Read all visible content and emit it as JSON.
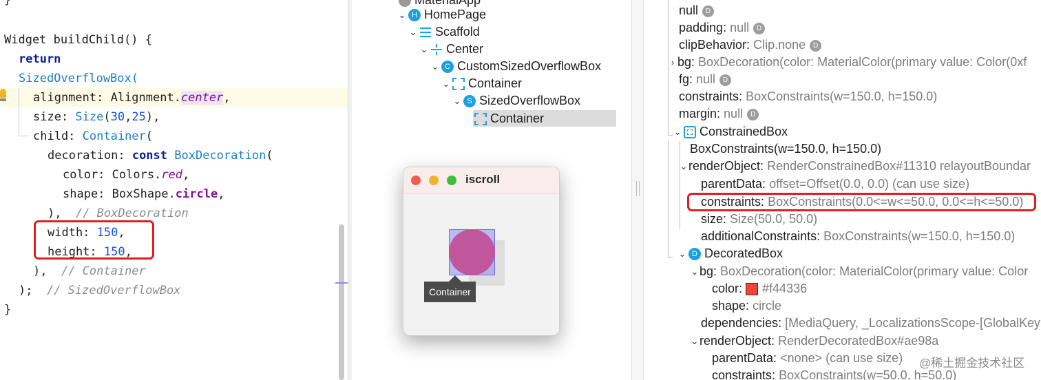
{
  "editor": {
    "top_fragment": "}",
    "lines": [
      {
        "t": "Widget buildChild() {"
      },
      {
        "t": "return"
      },
      {
        "t": "SizedOverflowBox("
      },
      {
        "a": "alignment: Alignment.",
        "b": "center",
        "c": ","
      },
      {
        "a": "size: ",
        "b": "Size",
        "c": "(",
        "d": "30",
        "e": ",",
        "f": "25",
        "g": "),"
      },
      {
        "a": "child: ",
        "b": "Container",
        "c": "("
      },
      {
        "a": "decoration: ",
        "b": "const",
        "c": " ",
        "d": "BoxDecoration",
        "e": "("
      },
      {
        "a": "color: Colors.",
        "b": "red",
        "c": ","
      },
      {
        "a": "shape: BoxShape.",
        "b": "circle",
        "c": ","
      },
      {
        "a": "),  ",
        "b": "// BoxDecoration"
      },
      {
        "a": "width: ",
        "b": "150",
        "c": ","
      },
      {
        "a": "height: ",
        "b": "150",
        "c": ","
      },
      {
        "a": "),  ",
        "b": "// Container"
      },
      {
        "a": ");  ",
        "b": "// SizedOverflowBox"
      },
      {
        "t": "}"
      }
    ]
  },
  "tree": {
    "items": [
      {
        "label": "MaterialApp",
        "badge": ""
      },
      {
        "label": "HomePage",
        "badge": "H"
      },
      {
        "label": "Scaffold"
      },
      {
        "label": "Center"
      },
      {
        "label": "CustomSizedOverflowBox",
        "badge": "C"
      },
      {
        "label": "Container"
      },
      {
        "label": "SizedOverflowBox",
        "badge": "S"
      },
      {
        "label": "Container"
      }
    ],
    "selected_index": 7
  },
  "app_window": {
    "title": "iscroll",
    "tooltip": "Container",
    "traffic_colors": [
      "#ee5b52",
      "#f1b32c",
      "#3fc03d"
    ],
    "widget_color": "#c0569b"
  },
  "props": {
    "rows": [
      {
        "name": "null",
        "val": "",
        "d": true
      },
      {
        "name": "padding:",
        "val": "null",
        "d": true
      },
      {
        "name": "clipBehavior:",
        "val": "Clip.none",
        "d": true
      },
      {
        "name": "bg:",
        "val": "BoxDecoration(color: MaterialColor(primary value: Color(0xf",
        "d": false
      },
      {
        "name": "fg:",
        "val": "null",
        "d": true
      },
      {
        "name": "constraints:",
        "val": "BoxConstraints(w=150.0, h=150.0)",
        "d": false
      },
      {
        "name": "margin:",
        "val": "null",
        "d": true
      },
      {
        "name": "ConstrainedBox",
        "val": "",
        "d": false
      },
      {
        "name": "BoxConstraints(w=150.0, h=150.0)",
        "val": "",
        "d": false
      },
      {
        "name": "renderObject:",
        "val": "RenderConstrainedBox#11310 relayoutBoundar",
        "d": false
      },
      {
        "name": "parentData:",
        "val": "offset=Offset(0.0, 0.0) (can use size)",
        "d": false
      },
      {
        "name": "constraints:",
        "val": "BoxConstraints(0.0<=w<=50.0, 0.0<=h<=50.0)",
        "d": false
      },
      {
        "name": "size:",
        "val": "Size(50.0, 50.0)",
        "d": false
      },
      {
        "name": "additionalConstraints:",
        "val": "BoxConstraints(w=150.0, h=150.0)",
        "d": false
      },
      {
        "name": "DecoratedBox",
        "val": "",
        "d": false
      },
      {
        "name": "bg:",
        "val": "BoxDecoration(color: MaterialColor(primary value: Color",
        "d": false
      },
      {
        "name": "color:",
        "val": "#f44336",
        "d": false
      },
      {
        "name": "shape:",
        "val": "circle",
        "d": false
      },
      {
        "name": "dependencies:",
        "val": "[MediaQuery, _LocalizationsScope-[GlobalKey",
        "d": false
      },
      {
        "name": "renderObject:",
        "val": "RenderDecoratedBox#ae98a",
        "d": false
      },
      {
        "name": "parentData:",
        "val": "<none> (can use size)",
        "d": false
      },
      {
        "name": "constraints:",
        "val": "BoxConstraints(w=50.0, h=50.0)",
        "d": false
      }
    ],
    "widget_badge_d": "D",
    "color_swatch": "#f44336"
  },
  "watermark": "@稀土掘金技术社区"
}
